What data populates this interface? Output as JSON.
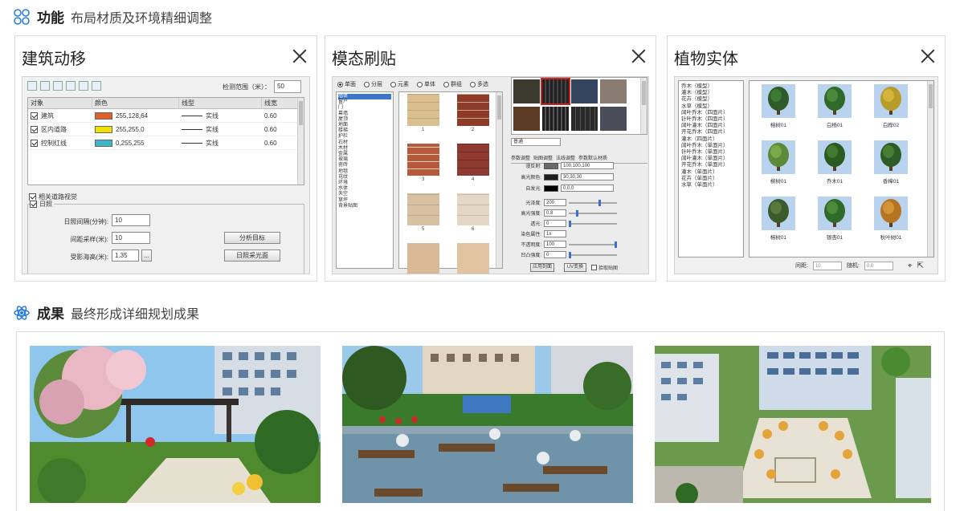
{
  "section_feature": {
    "title": "功能",
    "subtitle": "布局材质及环境精细调整"
  },
  "section_result": {
    "title": "成果",
    "subtitle": "最终形成详细规划成果"
  },
  "panel1": {
    "title": "建筑动移",
    "check_range_label": "检测范围（米）：",
    "check_range_value": "50",
    "columns": [
      "对象",
      "颜色",
      "线型",
      "线宽"
    ],
    "rows": [
      {
        "name": "建筑",
        "color": "#e0602a",
        "rgb": "255,128,64",
        "line": "实线",
        "width": "0.60"
      },
      {
        "name": "区内道路",
        "color": "#f2e000",
        "rgb": "255,255,0",
        "line": "实线",
        "width": "0.60"
      },
      {
        "name": "控制红线",
        "color": "#3fb5c8",
        "rgb": "0,255,255",
        "line": "实线",
        "width": "0.60"
      }
    ],
    "opt_road": "相关道路视觉",
    "opt_sun": "日照",
    "sun_interval_label": "日照间隔(分钟):",
    "sun_interval_value": "10",
    "spacing_label": "间距采样(米):",
    "spacing_value": "10",
    "shadow_label": "受影海高(米):",
    "shadow_value": "1.35",
    "ellipsis": "...",
    "btn_analyze": "分析目标",
    "btn_sunlight": "日照采光面"
  },
  "panel2": {
    "title": "模态刷贴",
    "radios": [
      "单面",
      "分层",
      "元素",
      "单体",
      "群组",
      "多选"
    ],
    "categories": [
      "墙体",
      "窗户",
      "门",
      "幕墙",
      "屋顶",
      "地面",
      "楼梯",
      "护栏",
      "石材",
      "木材",
      "金属",
      "玻璃",
      "瓷砖",
      "地毯",
      "花纹",
      "环境",
      "水体",
      "天空",
      "草坪",
      "背景贴图"
    ],
    "tex_nums": [
      "1",
      "2",
      "3",
      "4",
      "5",
      "6"
    ],
    "dropdown": "普通",
    "tabs": [
      "参数调整",
      "贴图调整",
      "法线调整",
      "参数默认材质"
    ],
    "params": [
      {
        "label": "漫反射:",
        "value": "100,100,100",
        "color": "#6a6a6a"
      },
      {
        "label": "高光颜色:",
        "value": "30,30,30",
        "color": "#1e1e1e"
      },
      {
        "label": "自发光:",
        "value": "0,0,0",
        "color": "#000000"
      }
    ],
    "numeric": [
      {
        "label": "光泽度:",
        "value": "200",
        "pos": 0.65
      },
      {
        "label": "高光强度:",
        "value": "0.8",
        "pos": 0.15
      },
      {
        "label": "透光:",
        "value": "0",
        "pos": 0.0
      },
      {
        "label": "染色属性:",
        "value": "1x",
        "pos": null
      },
      {
        "label": "不透明度:",
        "value": "100",
        "pos": 1.0
      },
      {
        "label": "凹凸强度:",
        "value": "0",
        "pos": 0.0
      }
    ],
    "btn_apply": "应用到面",
    "btn_uv": "UV变换",
    "chk_pick": "拾取贴图"
  },
  "panel3": {
    "title": "植物实体",
    "list": [
      "乔木（模型）",
      "灌木（模型）",
      "花卉（模型）",
      "水草（模型）",
      "阔叶乔木（四面片）",
      "针叶乔木（四面片）",
      "阔叶灌木（四面片）",
      "开花乔木（四面片）",
      "灌木（四面片）",
      "阔叶乔木（单面片）",
      "针叶乔木（单面片）",
      "阔叶灌木（单面片）",
      "开花乔木（单面片）",
      "灌木（单面片）",
      "花卉（单面片）",
      "水草（单面片）"
    ],
    "trees": [
      "榕树01",
      "白杨01",
      "白桦02",
      "柳树01",
      "乔木01",
      "香樟01",
      "榕树01",
      "银杏01",
      "秋叶树01"
    ],
    "spacing_label": "间距:",
    "spacing_value": "10",
    "random_label": "随机:",
    "random_value": "0.0"
  }
}
